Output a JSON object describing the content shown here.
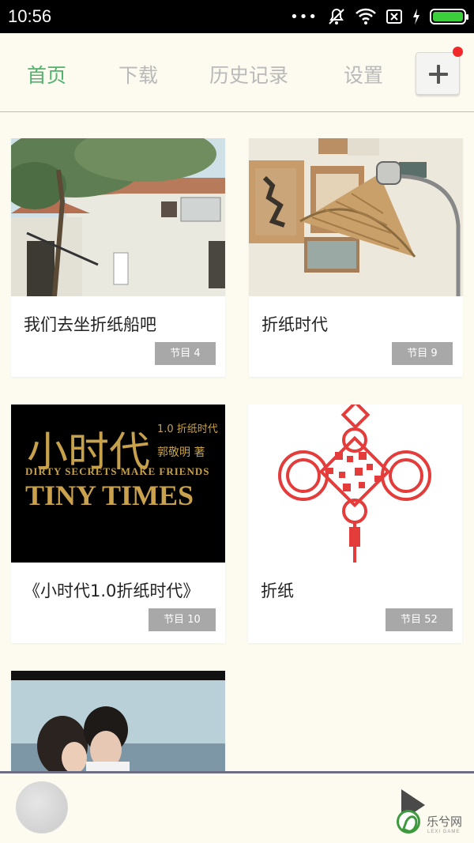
{
  "status_bar": {
    "time": "10:56",
    "battery_level": 1.0,
    "icons": [
      "more-dots-icon",
      "mute-icon",
      "wifi-icon",
      "sim-icon",
      "charging-icon",
      "battery-icon"
    ]
  },
  "tabs": [
    {
      "label": "首页",
      "active": true
    },
    {
      "label": "下载",
      "active": false
    },
    {
      "label": "历史记录",
      "active": false
    },
    {
      "label": "设置",
      "active": false
    }
  ],
  "add_button": {
    "icon": "plus-icon",
    "has_notification": true
  },
  "colors": {
    "accent": "#4cb56b",
    "tab_inactive": "#b9b9b9",
    "badge": "#a8a8a8",
    "background": "#fdfaf0",
    "notification": "#f02a2a"
  },
  "cards": [
    {
      "title": "我们去坐折纸船吧",
      "badge": "节目 4",
      "image": "house-tree-photo"
    },
    {
      "title": "折纸时代",
      "badge": "节目 9",
      "image": "wicker-lamp-photo"
    },
    {
      "title": "《小时代1.0折纸时代》",
      "badge": "节目 10",
      "image": "tiny-times-poster",
      "poster": {
        "title_cn": "小时代",
        "subtitle": "1.0 折纸时代",
        "author": "郭敬明 著",
        "line1": "DIRTY SECRETS MAKE FRIENDS",
        "line2": "TINY TIMES"
      }
    },
    {
      "title": "折纸",
      "badge": "节目 52",
      "image": "chinese-knot-qr"
    },
    {
      "title": "",
      "badge": "",
      "image": "couple-beach-photo"
    }
  ],
  "player": {
    "avatar": "album-avatar",
    "play_icon": "play-icon"
  },
  "watermark": {
    "text": "乐兮网",
    "sub": "LEXI GAME"
  }
}
